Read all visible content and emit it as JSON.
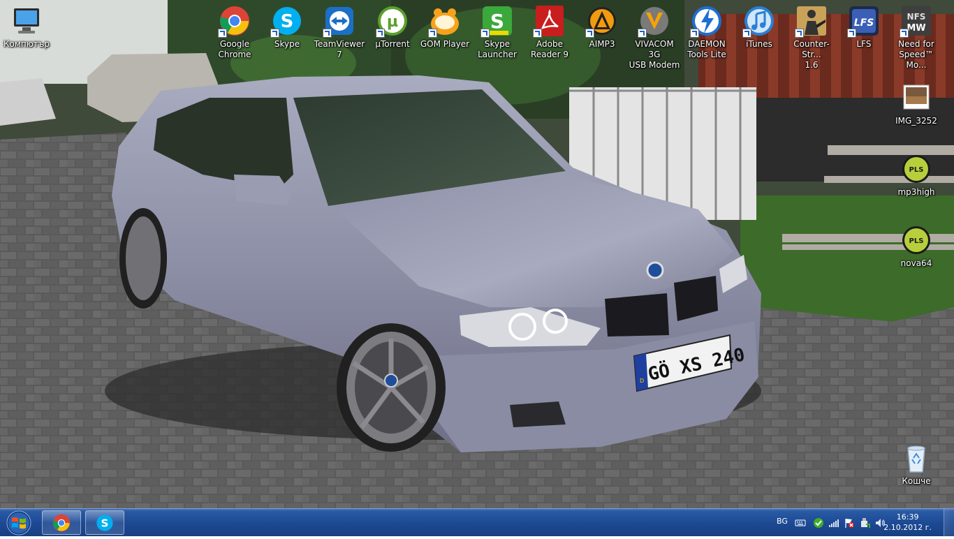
{
  "desktop_icons": [
    {
      "label": "Компютър",
      "icon": "computer-icon",
      "shortcut": false
    },
    {
      "label": "Google\nChrome",
      "icon": "chrome-icon",
      "shortcut": true
    },
    {
      "label": "Skype",
      "icon": "skype-icon",
      "shortcut": true
    },
    {
      "label": "TeamViewer\n7",
      "icon": "teamviewer-icon",
      "shortcut": true
    },
    {
      "label": "µTorrent",
      "icon": "utorrent-icon",
      "shortcut": true
    },
    {
      "label": "GOM Player",
      "icon": "gom-player-icon",
      "shortcut": true
    },
    {
      "label": "Skype\nLauncher",
      "icon": "skype-launcher-icon",
      "shortcut": true
    },
    {
      "label": "Adobe\nReader 9",
      "icon": "adobe-reader-icon",
      "shortcut": true
    },
    {
      "label": "AIMP3",
      "icon": "aimp-icon",
      "shortcut": true
    },
    {
      "label": "VIVACOM 3G\nUSB Modem",
      "icon": "vivacom-icon",
      "shortcut": true
    },
    {
      "label": "DAEMON\nTools Lite",
      "icon": "daemon-tools-icon",
      "shortcut": true
    },
    {
      "label": "iTunes",
      "icon": "itunes-icon",
      "shortcut": true
    },
    {
      "label": "Counter-Str...\n1.6",
      "icon": "counter-strike-icon",
      "shortcut": true
    },
    {
      "label": "LFS",
      "icon": "lfs-icon",
      "shortcut": true
    },
    {
      "label": "Need for\nSpeed™ Mo...",
      "icon": "need-for-speed-icon",
      "shortcut": true
    },
    {
      "label": "IMG_3252",
      "icon": "image-file-icon",
      "shortcut": false
    },
    {
      "label": "mp3high",
      "icon": "pls-playlist-icon",
      "shortcut": false,
      "badge": "PLS"
    },
    {
      "label": "nova64",
      "icon": "pls-playlist-icon",
      "shortcut": false,
      "badge": "PLS"
    },
    {
      "label": "Кошче",
      "icon": "recycle-bin-icon",
      "shortcut": false
    }
  ],
  "wallpaper": {
    "license_plate": "GÖ XS 240",
    "plate_country": "D"
  },
  "taskbar": {
    "pinned": [
      {
        "icon": "chrome-icon"
      },
      {
        "icon": "skype-icon"
      }
    ],
    "tray": {
      "language": "BG",
      "time": "16:39",
      "date": "2.10.2012 г."
    }
  },
  "colors": {
    "taskbar": "#1d4a94",
    "chrome_red": "#db4437",
    "skype_blue": "#00aff0",
    "utorrent_green": "#5aa02c"
  }
}
